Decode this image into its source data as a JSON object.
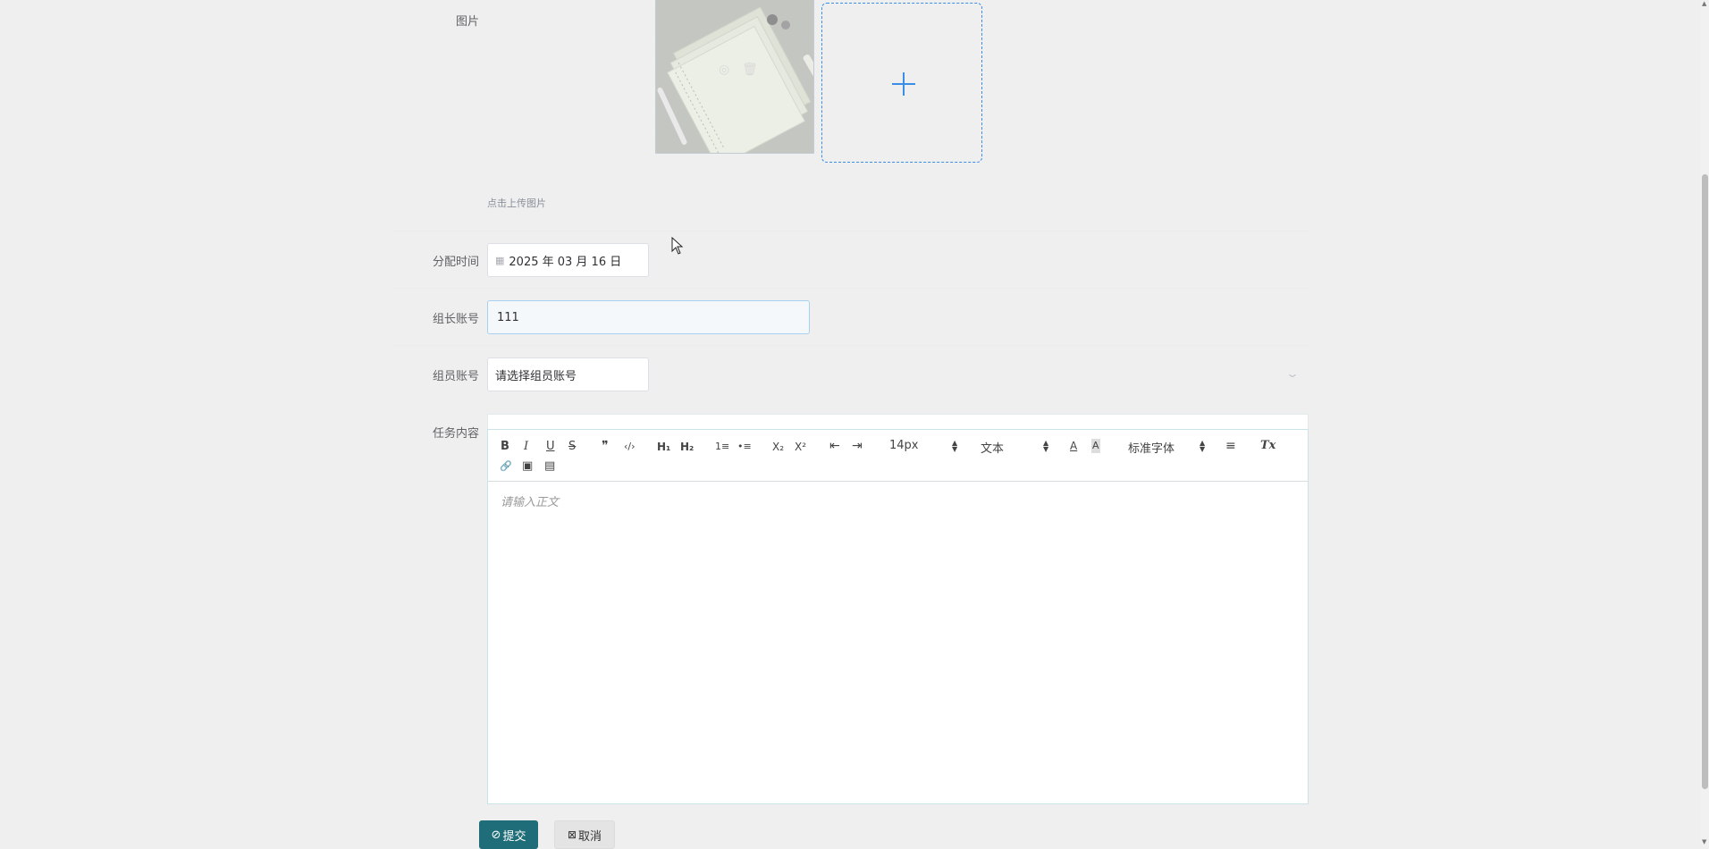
{
  "form": {
    "image": {
      "label": "图片",
      "thumbnail_actions": [
        "preview-icon",
        "delete-icon"
      ],
      "tip": "点击上传图片"
    },
    "assign_time": {
      "label": "分配时间",
      "value": "2025 年 03 月 16 日"
    },
    "leader_account": {
      "label": "组长账号",
      "value": "111"
    },
    "member_account": {
      "label": "组员账号",
      "placeholder": "请选择组员账号"
    },
    "task_content": {
      "label": "任务内容",
      "editor": {
        "toolbar": {
          "bold": "B",
          "italic": "I",
          "underline": "U",
          "strike": "S",
          "quote": "❞",
          "code": "‹/›",
          "h1": "H₁",
          "h2": "H₂",
          "ordered_list": "1≡",
          "bullet_list": "•≡",
          "subscript": "X₂",
          "superscript": "X²",
          "outdent": "⇤",
          "indent": "⇥",
          "size": "14px",
          "header": "文本",
          "color": "A",
          "background": "A",
          "font": "标准字体",
          "align": "≡",
          "clean": "Tx",
          "link": "🔗",
          "image": "▣",
          "video": "▤"
        },
        "placeholder": "请输入正文"
      }
    },
    "buttons": {
      "submit": "提交",
      "cancel": "取消"
    }
  },
  "colors": {
    "primary": "#1f6d78",
    "upload_border": "#3a8ee6",
    "page_bg": "#efefef"
  }
}
